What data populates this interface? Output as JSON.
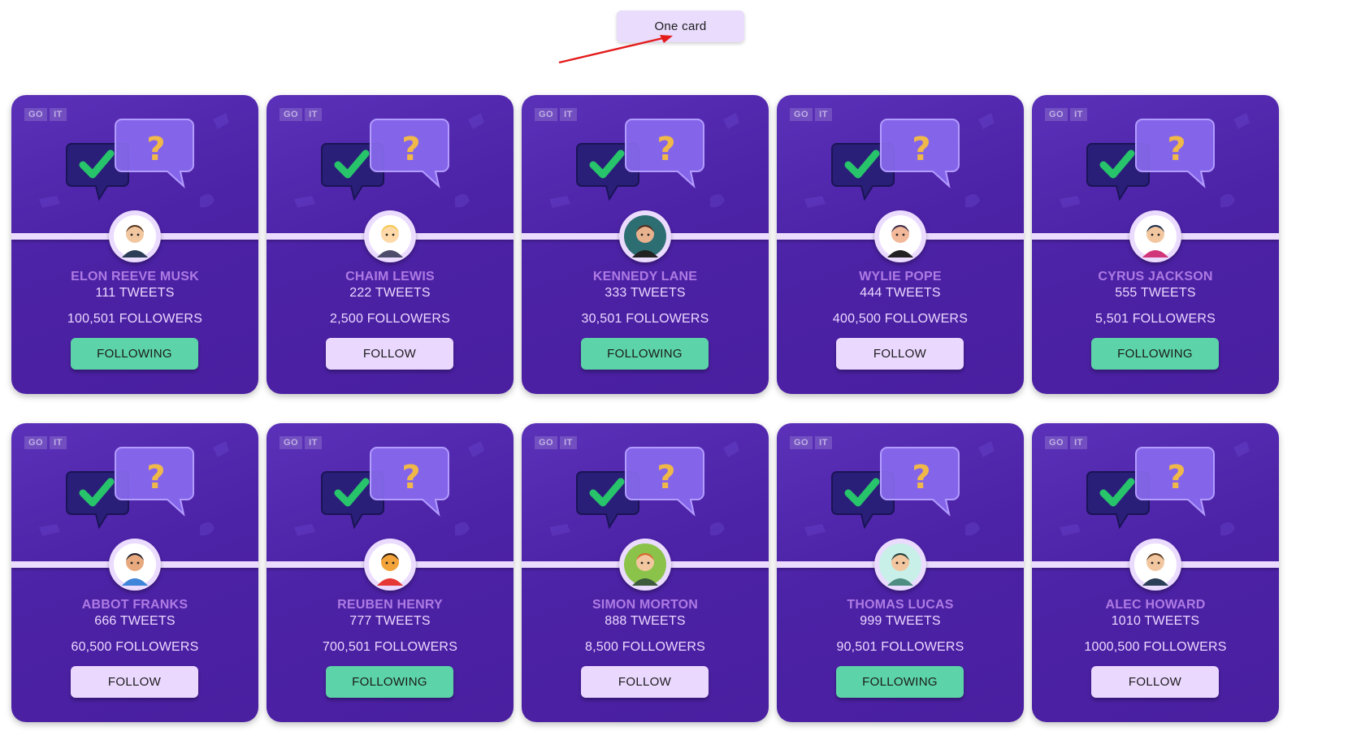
{
  "top_button": {
    "label": "One card"
  },
  "logo": {
    "part1": "GO",
    "part2": "IT"
  },
  "colors": {
    "card_bg": "#4b21a3",
    "following": "#5cd3a8",
    "follow": "#ebd8ff",
    "name_text": "#ae7be3",
    "arrow": "#e31b1b"
  },
  "cards": [
    {
      "name": "ELON REEVE MUSK",
      "tweets": "111 TWEETS",
      "followers": "100,501 FOLLOWERS",
      "button": "FOLLOWING",
      "following": true,
      "avatar_icon": "man-suit-avatar-icon"
    },
    {
      "name": "CHAIM LEWIS",
      "tweets": "222 TWEETS",
      "followers": "2,500 FOLLOWERS",
      "button": "FOLLOW",
      "following": false,
      "avatar_icon": "blond-boy-avatar-icon"
    },
    {
      "name": "KENNEDY LANE",
      "tweets": "333 TWEETS",
      "followers": "30,501 FOLLOWERS",
      "button": "FOLLOWING",
      "following": true,
      "avatar_icon": "woman-avatar-icon"
    },
    {
      "name": "WYLIE POPE",
      "tweets": "444 TWEETS",
      "followers": "400,500 FOLLOWERS",
      "button": "FOLLOW",
      "following": false,
      "avatar_icon": "man-cocktail-avatar-icon"
    },
    {
      "name": "CYRUS JACKSON",
      "tweets": "555 TWEETS",
      "followers": "5,501 FOLLOWERS",
      "button": "FOLLOWING",
      "following": true,
      "avatar_icon": "woman-dark-hair-avatar-icon"
    },
    {
      "name": "ABBOT FRANKS",
      "tweets": "666 TWEETS",
      "followers": "60,500 FOLLOWERS",
      "button": "FOLLOW",
      "following": false,
      "avatar_icon": "man-glasses-avatar-icon"
    },
    {
      "name": "REUBEN HENRY",
      "tweets": "777 TWEETS",
      "followers": "700,501 FOLLOWERS",
      "button": "FOLLOWING",
      "following": true,
      "avatar_icon": "man-red-shirt-avatar-icon"
    },
    {
      "name": "SIMON MORTON",
      "tweets": "888 TWEETS",
      "followers": "8,500 FOLLOWERS",
      "button": "FOLLOW",
      "following": false,
      "avatar_icon": "redhead-avatar-icon"
    },
    {
      "name": "THOMAS LUCAS",
      "tweets": "999 TWEETS",
      "followers": "90,501 FOLLOWERS",
      "button": "FOLLOWING",
      "following": true,
      "avatar_icon": "graduate-avatar-icon"
    },
    {
      "name": "ALEC HOWARD",
      "tweets": "1010 TWEETS",
      "followers": "1000,500 FOLLOWERS",
      "button": "FOLLOW",
      "following": false,
      "avatar_icon": "man-suit-avatar-icon"
    }
  ]
}
